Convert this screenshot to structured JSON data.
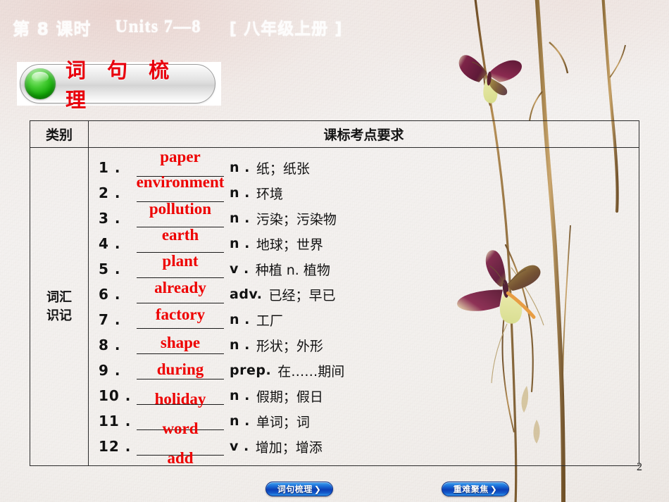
{
  "header": {
    "lesson": "第 8 课时",
    "units": "Units 7—8",
    "grade": "[ 八年级上册 ]"
  },
  "section": {
    "title": "词 句 梳 理",
    "dot": "green-circle-icon"
  },
  "table": {
    "columns": [
      "类别",
      "课标考点要求"
    ],
    "category": "词汇\n识记",
    "category_line1": "词汇",
    "category_line2": "识记",
    "rows": [
      {
        "num": "1 .",
        "answer": "paper",
        "pos": "n .",
        "meaning": "纸；纸张"
      },
      {
        "num": "2 .",
        "answer": "environment",
        "pos": "n .",
        "meaning": "环境"
      },
      {
        "num": "3 .",
        "answer": "pollution",
        "pos": "n .",
        "meaning": "污染；污染物"
      },
      {
        "num": "4 .",
        "answer": "earth",
        "pos": "n .",
        "meaning": "地球；世界"
      },
      {
        "num": "5 .",
        "answer": "plant",
        "pos": "v .",
        "meaning": "种植 n. 植物"
      },
      {
        "num": "6 .",
        "answer": "already",
        "pos": "adv.",
        "meaning": "已经；早已"
      },
      {
        "num": "7 .",
        "answer": "factory",
        "pos": "n .",
        "meaning": "工厂"
      },
      {
        "num": "8 .",
        "answer": "shape",
        "pos": "n .",
        "meaning": "形状；外形"
      },
      {
        "num": "9 .",
        "answer": "during",
        "pos": "prep.",
        "meaning": "在……期间"
      },
      {
        "num": "10 .",
        "answer": "holiday",
        "pos": "n .",
        "meaning": "假期；假日"
      },
      {
        "num": "11 .",
        "answer": "word",
        "pos": "n .",
        "meaning": "单词；词"
      },
      {
        "num": "12 .",
        "answer": "add",
        "pos": "v .",
        "meaning": "增加；增添"
      }
    ]
  },
  "nav": {
    "left_label": "词句梳理",
    "right_label": "重难聚焦",
    "chevron": "❯"
  },
  "page_number": "2",
  "colors": {
    "answer_red": "#ee0000",
    "section_red": "#e8000c",
    "nav_blue": "#0c3fb5",
    "dot_green": "#12a906",
    "background": "#f3f0ed",
    "border": "#2a2a2a"
  }
}
